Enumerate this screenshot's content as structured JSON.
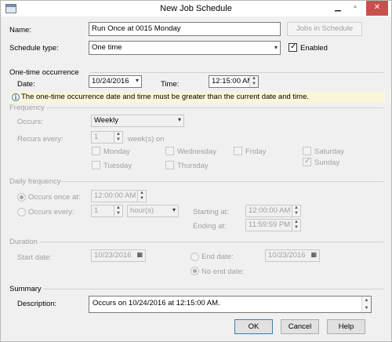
{
  "window": {
    "title": "New Job Schedule",
    "close_symbol": "✕",
    "minimize_symbol": "▁",
    "maximize_symbol": "▫"
  },
  "name": {
    "label": "Name:",
    "value": "Run Once at 0015 Monday",
    "jobs_button": "Jobs in Schedule"
  },
  "schedule_type": {
    "label": "Schedule type:",
    "value": "One time",
    "enabled_label": "Enabled",
    "enabled": true
  },
  "one_time": {
    "heading": "One-time occurrence",
    "date_label": "Date:",
    "date_value": "10/24/2016",
    "time_label": "Time:",
    "time_value": "12:15:00 AM",
    "info_text": "The one-time occurrence date and time must be greater than the current date and time."
  },
  "frequency": {
    "heading": "Frequency",
    "occurs_label": "Occurs:",
    "occurs_value": "Weekly",
    "recurs_label": "Recurs every:",
    "recurs_value": "1",
    "recurs_unit": "week(s) on",
    "days": [
      {
        "label": "Monday",
        "checked": false
      },
      {
        "label": "Wednesday",
        "checked": false
      },
      {
        "label": "Friday",
        "checked": false
      },
      {
        "label": "Saturday",
        "checked": false
      },
      {
        "label": "Tuesday",
        "checked": false
      },
      {
        "label": "Thursday",
        "checked": false
      },
      {
        "label": "Sunday",
        "checked": true
      }
    ]
  },
  "daily": {
    "heading": "Daily frequency",
    "once_label": "Occurs once at:",
    "once_value": "12:00:00 AM",
    "every_label": "Occurs every:",
    "every_value": "1",
    "every_unit": "hour(s)",
    "starting_label": "Starting at:",
    "starting_value": "12:00:00 AM",
    "ending_label": "Ending at:",
    "ending_value": "11:59:59 PM"
  },
  "duration": {
    "heading": "Duration",
    "start_label": "Start date:",
    "start_value": "10/23/2016",
    "end_label": "End date:",
    "end_value": "10/23/2016",
    "no_end_label": "No end date:"
  },
  "summary": {
    "heading": "Summary",
    "desc_label": "Description:",
    "desc_value": "Occurs on 10/24/2016 at 12:15:00 AM."
  },
  "buttons": {
    "ok": "OK",
    "cancel": "Cancel",
    "help": "Help"
  },
  "icons": {
    "check": "✓",
    "combo_arrow": "▾",
    "calendar": "▦",
    "info": "i",
    "spin_up": "▲",
    "spin_down": "▼"
  }
}
